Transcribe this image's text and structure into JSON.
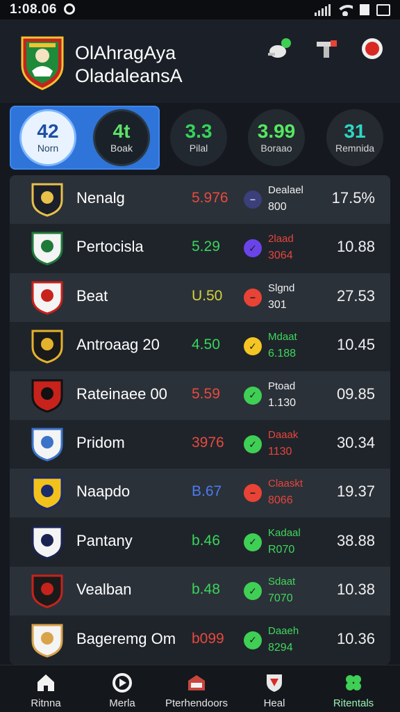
{
  "status_bar": {
    "time": "1:08.06"
  },
  "header": {
    "club_name_line1": "OlAhragAya",
    "club_name_line2": "OladaleansA"
  },
  "stat_chips": [
    {
      "value": "42",
      "label": "Norn"
    },
    {
      "value": "4t",
      "label": "Boak"
    },
    {
      "value": "3.3",
      "label": "Pilal"
    },
    {
      "value": "3.99",
      "label": "Boraao"
    },
    {
      "value": "31",
      "label": "Remnida"
    }
  ],
  "rows": [
    {
      "name": "Nenalg",
      "score": "5.976",
      "score_color": "#e84a3c",
      "dot_color": "#3b3f7a",
      "dot_mark": "−",
      "sub1": "Dealael",
      "sub2": "800",
      "sub_color": "#f0f0f0",
      "pct": "17.5%"
    },
    {
      "name": "Pertocisla",
      "score": "5.29",
      "score_color": "#39d65a",
      "dot_color": "#6a44e8",
      "dot_mark": "✓",
      "sub1": "2laad",
      "sub2": "3064",
      "sub_color": "#e8453b",
      "pct": "10.88"
    },
    {
      "name": "Beat",
      "score": "U.50",
      "score_color": "#d6d23a",
      "dot_color": "#e84335",
      "dot_mark": "−",
      "sub1": "Slgnd",
      "sub2": "301",
      "sub_color": "#f0f0f0",
      "pct": "27.53"
    },
    {
      "name": "Antroaag 20",
      "score": "4.50",
      "score_color": "#39d65a",
      "dot_color": "#f5c623",
      "dot_mark": "✓",
      "sub1": "Mdaat",
      "sub2": "6.188",
      "sub_color": "#3fd85a",
      "pct": "10.45"
    },
    {
      "name": "Rateinaee 00",
      "score": "5.59",
      "score_color": "#e84a3c",
      "dot_color": "#3fcf54",
      "dot_mark": "✓",
      "sub1": "Ptoad",
      "sub2": "1.130",
      "sub_color": "#f0f0f0",
      "pct": "09.85"
    },
    {
      "name": "Pridom",
      "score": "3976",
      "score_color": "#e84a3c",
      "dot_color": "#3fcf54",
      "dot_mark": "✓",
      "sub1": "Daaak",
      "sub2": "1130",
      "sub_color": "#e8453b",
      "pct": "30.34"
    },
    {
      "name": "Naapdo",
      "score": "B.67",
      "score_color": "#4a7bf0",
      "dot_color": "#e84335",
      "dot_mark": "−",
      "sub1": "Claaskt",
      "sub2": "8066",
      "sub_color": "#e8453b",
      "pct": "19.37"
    },
    {
      "name": "Pantany",
      "score": "b.46",
      "score_color": "#39d65a",
      "dot_color": "#3fcf54",
      "dot_mark": "✓",
      "sub1": "Kadaal",
      "sub2": "R070",
      "sub_color": "#3fd85a",
      "pct": "38.88"
    },
    {
      "name": "Vealban",
      "score": "b.48",
      "score_color": "#39d65a",
      "dot_color": "#3fcf54",
      "dot_mark": "✓",
      "sub1": "Sdaat",
      "sub2": "7070",
      "sub_color": "#3fd85a",
      "pct": "10.38"
    },
    {
      "name": "Bageremg Om",
      "score": "b099",
      "score_color": "#e84a3c",
      "dot_color": "#3fcf54",
      "dot_mark": "✓",
      "sub1": "Daaeh",
      "sub2": "8294",
      "sub_color": "#3fd85a",
      "pct": "10.36"
    }
  ],
  "nav": [
    {
      "label": "Ritnna",
      "icon": "home-icon"
    },
    {
      "label": "Merla",
      "icon": "media-icon"
    },
    {
      "label": "Pterhendoors",
      "icon": "stadium-icon"
    },
    {
      "label": "Heal",
      "icon": "shield-icon"
    },
    {
      "label": "Ritentals",
      "icon": "leaf-icon"
    }
  ],
  "colors": {
    "background": "#15191f",
    "accent_blue": "#2f74d8",
    "positive": "#39d65a",
    "negative": "#e84a3c"
  }
}
